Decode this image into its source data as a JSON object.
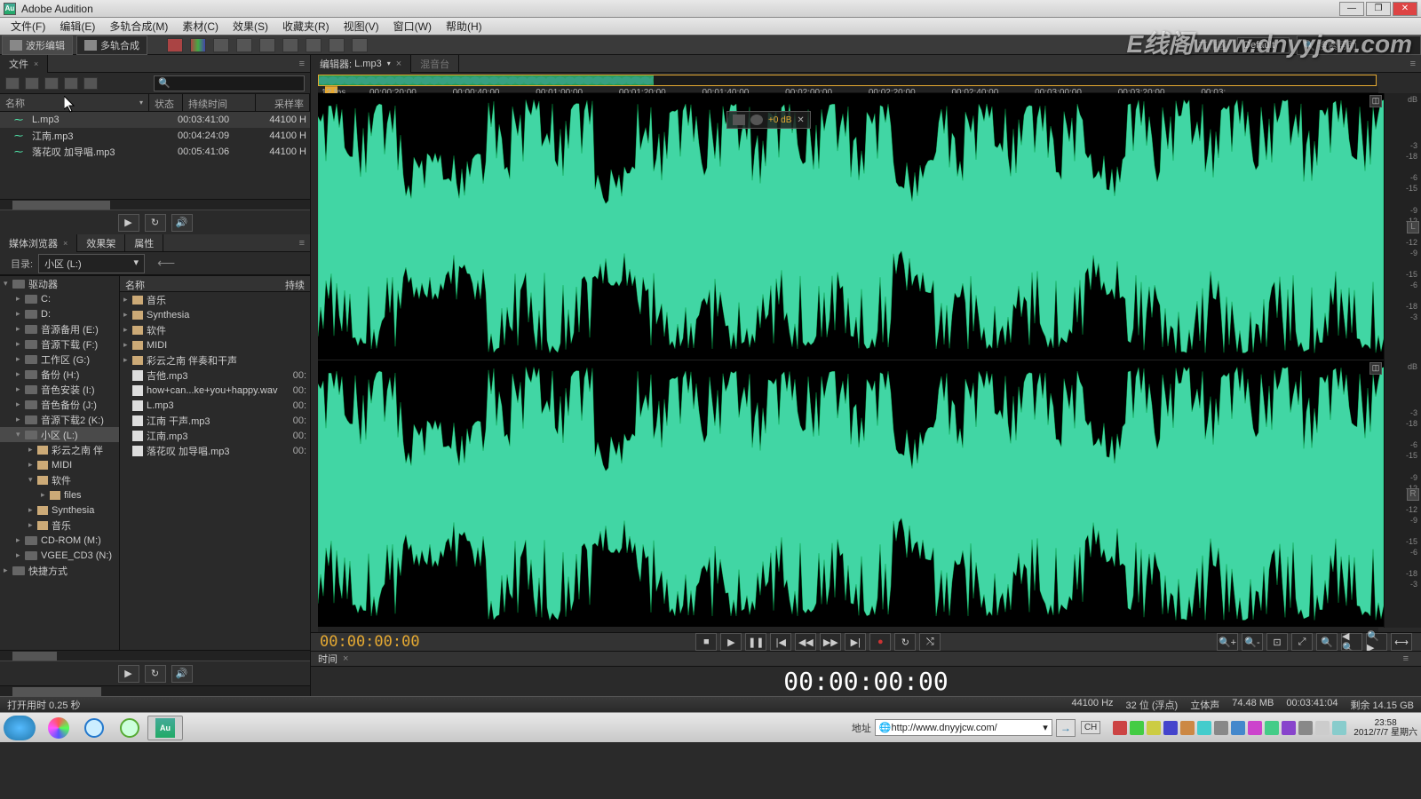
{
  "window": {
    "app_name": "Adobe Audition",
    "app_initials": "Au"
  },
  "menu": [
    "文件(F)",
    "编辑(E)",
    "多轨合成(M)",
    "素材(C)",
    "效果(S)",
    "收藏夹(R)",
    "视图(V)",
    "窗口(W)",
    "帮助(H)"
  ],
  "mode": {
    "waveform": "波形编辑",
    "multitrack": "多轨合成"
  },
  "workspace": {
    "label": "工作区:",
    "value": "Default",
    "search_placeholder": "搜索帮助"
  },
  "files_panel": {
    "tab": "文件",
    "headers": {
      "name": "名称",
      "status": "状态",
      "duration": "持续时间",
      "samplerate": "采样率"
    },
    "rows": [
      {
        "name": "L.mp3",
        "duration": "00:03:41:00",
        "samplerate": "44100 H"
      },
      {
        "name": "江南.mp3",
        "duration": "00:04:24:09",
        "samplerate": "44100 H"
      },
      {
        "name": "落花叹 加导唱.mp3",
        "duration": "00:05:41:06",
        "samplerate": "44100 H"
      }
    ]
  },
  "media_panel": {
    "tabs": [
      "媒体浏览器",
      "效果架",
      "属性"
    ],
    "dir_label": "目录:",
    "dir_value": "小区 (L:)",
    "tree_header": "驱动器",
    "tree": [
      {
        "label": "C:",
        "indent": 1,
        "type": "drive"
      },
      {
        "label": "D:",
        "indent": 1,
        "type": "drive"
      },
      {
        "label": "音源备用 (E:)",
        "indent": 1,
        "type": "drive"
      },
      {
        "label": "音源下载 (F:)",
        "indent": 1,
        "type": "drive"
      },
      {
        "label": "工作区 (G:)",
        "indent": 1,
        "type": "drive"
      },
      {
        "label": "备份 (H:)",
        "indent": 1,
        "type": "drive"
      },
      {
        "label": "音色安装 (I:)",
        "indent": 1,
        "type": "drive"
      },
      {
        "label": "音色备份 (J:)",
        "indent": 1,
        "type": "drive"
      },
      {
        "label": "音源下载2 (K:)",
        "indent": 1,
        "type": "drive"
      },
      {
        "label": "小区 (L:)",
        "indent": 1,
        "type": "drive",
        "selected": true,
        "expanded": true
      },
      {
        "label": "彩云之南 伴",
        "indent": 2,
        "type": "folder"
      },
      {
        "label": "MIDI",
        "indent": 2,
        "type": "folder"
      },
      {
        "label": "软件",
        "indent": 2,
        "type": "folder",
        "expanded": true
      },
      {
        "label": "files",
        "indent": 3,
        "type": "folder"
      },
      {
        "label": "Synthesia",
        "indent": 2,
        "type": "folder"
      },
      {
        "label": "音乐",
        "indent": 2,
        "type": "folder"
      },
      {
        "label": "CD-ROM (M:)",
        "indent": 1,
        "type": "drive"
      },
      {
        "label": "VGEE_CD3 (N:)",
        "indent": 1,
        "type": "drive"
      }
    ],
    "shortcuts": "快捷方式",
    "browser_headers": {
      "name": "名称",
      "duration": "持续"
    },
    "browser": [
      {
        "name": "音乐",
        "type": "folder"
      },
      {
        "name": "Synthesia",
        "type": "folder"
      },
      {
        "name": "软件",
        "type": "folder"
      },
      {
        "name": "MIDI",
        "type": "folder"
      },
      {
        "name": "彩云之南 伴奏和干声",
        "type": "folder"
      },
      {
        "name": "吉他.mp3",
        "type": "file",
        "dur": "00:"
      },
      {
        "name": "how+can...ke+you+happy.wav",
        "type": "file",
        "dur": "00:"
      },
      {
        "name": "L.mp3",
        "type": "file",
        "dur": "00:"
      },
      {
        "name": "江南 干声.mp3",
        "type": "file",
        "dur": "00:"
      },
      {
        "name": "江南.mp3",
        "type": "file",
        "dur": "00:"
      },
      {
        "name": "落花叹 加导唱.mp3",
        "type": "file",
        "dur": "00:"
      }
    ]
  },
  "editor": {
    "tab_prefix": "编辑器:",
    "tab_file": "L.mp3",
    "mixer_tab": "混音台",
    "fps": "12 fps",
    "ticks": [
      "00:00:20:00",
      "00:00:40:00",
      "00:01:00:00",
      "00:01:20:00",
      "00:01:40:00",
      "00:02:00:00",
      "00:02:20:00",
      "00:02:40:00",
      "00:03:00:00",
      "00:03:20:00",
      "00:03:"
    ],
    "hud_db": "+0 dB",
    "db_label": "dB",
    "db_values": [
      "-3",
      "-6",
      "-9",
      "-12",
      "-15",
      "-18"
    ],
    "ch_left": "L",
    "ch_right": "R"
  },
  "transport": {
    "timecode": "00:00:00:00"
  },
  "time_panel": {
    "tab": "时间",
    "big": "00:00:00:00"
  },
  "status": {
    "left": "打开用时 0.25 秒",
    "right": [
      "44100 Hz",
      "32 位 (浮点)",
      "立体声",
      "74.48 MB",
      "00:03:41:04",
      "剩余 14.15 GB"
    ]
  },
  "taskbar": {
    "addr_label": "地址",
    "url": "http://www.dnyyjcw.com/",
    "lang": "CH",
    "clock_time": "23:58",
    "clock_date": "2012/7/7 星期六"
  },
  "watermark": "E线阁www.dnyyjcw.com"
}
